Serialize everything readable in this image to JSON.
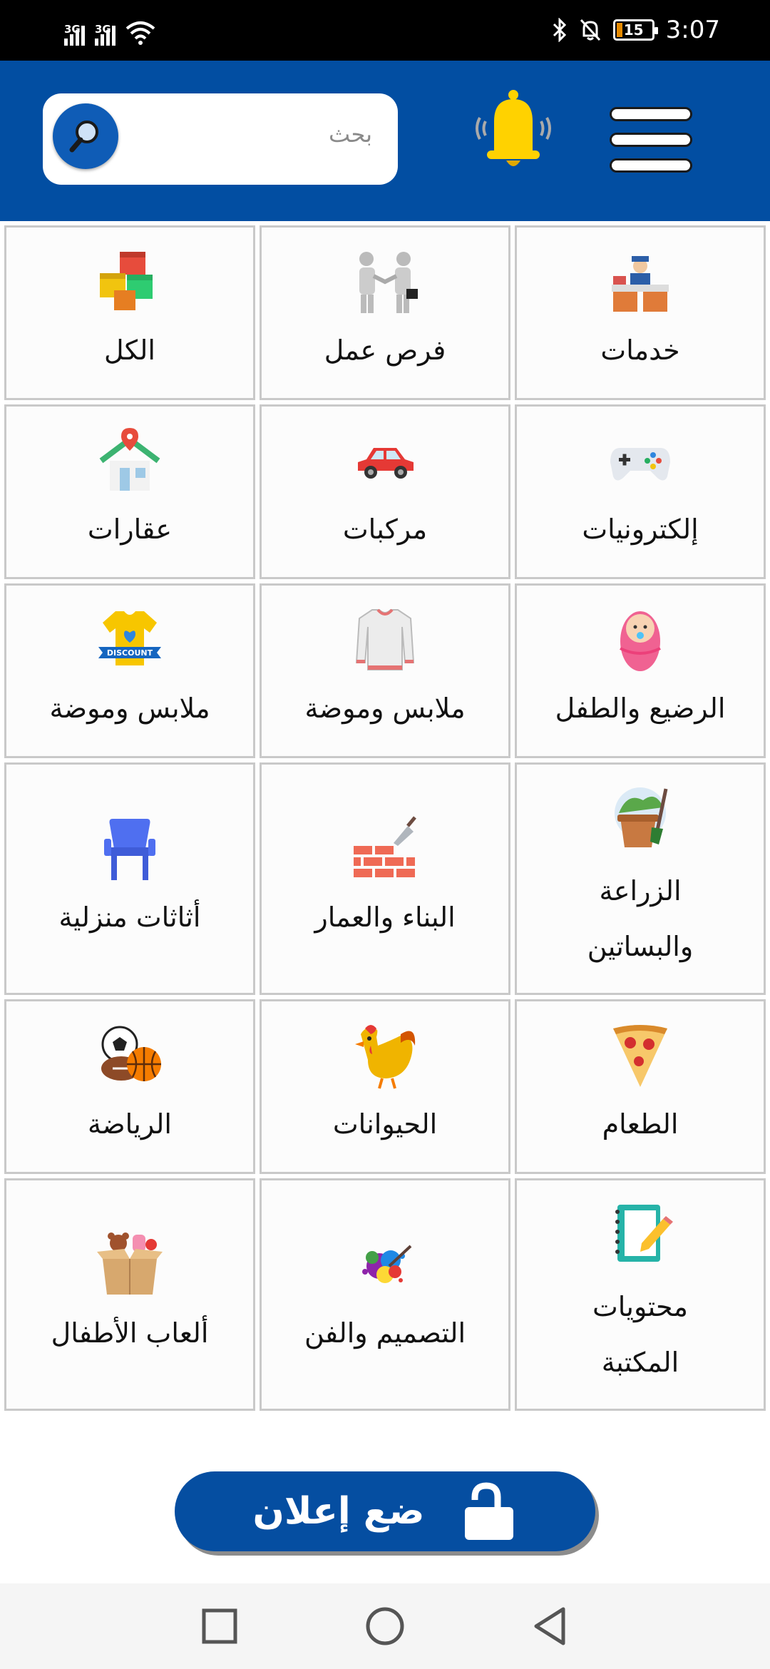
{
  "status_bar": {
    "signal_1": "3G",
    "signal_2": "3G",
    "battery_level": "15",
    "time": "3:07"
  },
  "header": {
    "search_placeholder": "بحث",
    "colors": {
      "header_bg": "#024ea2",
      "bell": "#ffd200"
    }
  },
  "categories": [
    {
      "label": "خدمات",
      "icon": "service-desk-icon"
    },
    {
      "label": "فرص عمل",
      "icon": "handshake-icon"
    },
    {
      "label": "الكل",
      "icon": "colorful-boxes-icon"
    },
    {
      "label": "إلكترونيات",
      "icon": "gamepad-icon"
    },
    {
      "label": "مركبات",
      "icon": "car-icon"
    },
    {
      "label": "عقارات",
      "icon": "house-pin-icon"
    },
    {
      "label": "الرضيع والطفل",
      "icon": "baby-icon"
    },
    {
      "label": "ملابس وموضة",
      "icon": "sweater-icon"
    },
    {
      "label": "ملابس وموضة",
      "icon": "discount-shirt-icon"
    },
    {
      "label": "الزراعة والبساتين",
      "label_line1": "الزراعة",
      "label_line2": "والبساتين",
      "icon": "plant-pot-icon"
    },
    {
      "label": "البناء والعمار",
      "icon": "brick-trowel-icon"
    },
    {
      "label": "أثاثات منزلية",
      "icon": "chair-icon"
    },
    {
      "label": "الطعام",
      "icon": "pizza-icon"
    },
    {
      "label": "الحيوانات",
      "icon": "rooster-icon"
    },
    {
      "label": "الرياضة",
      "icon": "sports-balls-icon"
    },
    {
      "label": "محتويات المكتبة",
      "label_line1": "محتويات",
      "label_line2": "المكتبة",
      "icon": "notebook-pencil-icon"
    },
    {
      "label": "التصميم والفن",
      "icon": "paint-splash-icon"
    },
    {
      "label": "ألعاب الأطفال",
      "icon": "toy-box-icon"
    }
  ],
  "post_ad": {
    "label": "ضع إعلان",
    "icon": "unlock-icon"
  },
  "nav": {
    "icons": [
      "recents-square-icon",
      "home-circle-icon",
      "back-triangle-icon"
    ]
  }
}
